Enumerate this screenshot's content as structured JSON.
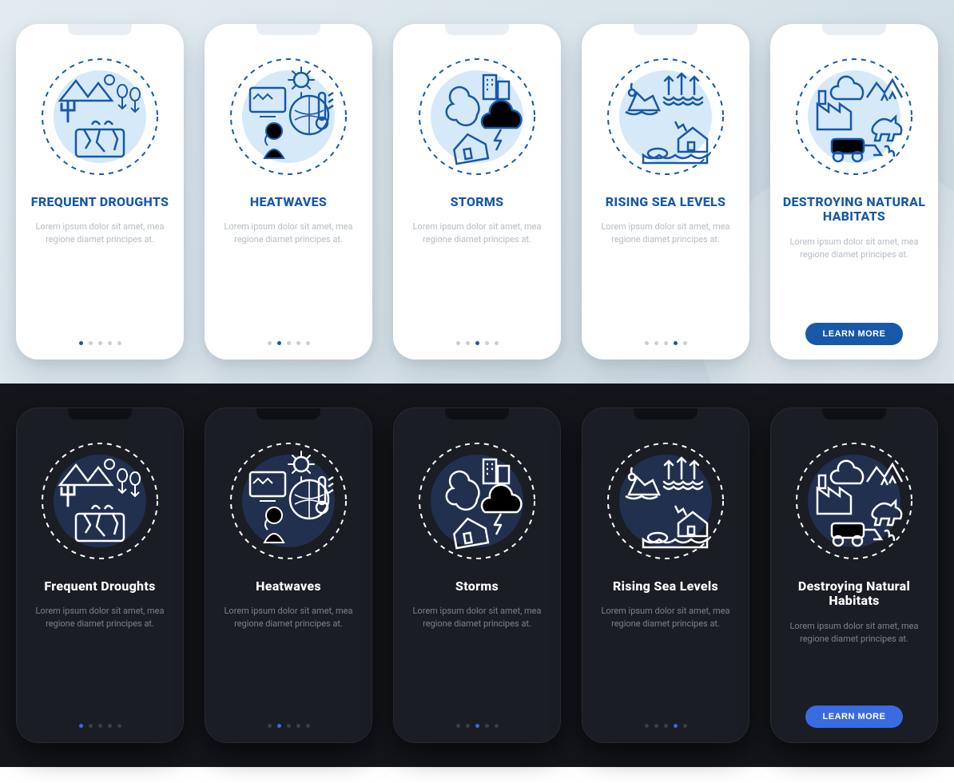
{
  "placeholder_text": "Lorem ipsum dolor sit amet, mea regione diamet principes at.",
  "cta_label": "LEARN MORE",
  "light": {
    "cards": [
      {
        "title": "FREQUENT DROUGHTS",
        "icon": "drought-icon"
      },
      {
        "title": "HEATWAVES",
        "icon": "heatwave-icon"
      },
      {
        "title": "STORMS",
        "icon": "storm-icon"
      },
      {
        "title": "RISING SEA LEVELS",
        "icon": "sea-level-icon"
      },
      {
        "title": "DESTROYING NATURAL HABITATS",
        "icon": "habitat-icon"
      }
    ]
  },
  "dark": {
    "cards": [
      {
        "title": "Frequent Droughts",
        "icon": "drought-icon"
      },
      {
        "title": "Heatwaves",
        "icon": "heatwave-icon"
      },
      {
        "title": "Storms",
        "icon": "storm-icon"
      },
      {
        "title": "Rising Sea Levels",
        "icon": "sea-level-icon"
      },
      {
        "title": "Destroying Natural Habitats",
        "icon": "habitat-icon"
      }
    ]
  },
  "colors": {
    "light_accent": "#1759a6",
    "light_fill": "#9ec9ee",
    "dark_accent": "#3a6be0",
    "dark_stroke": "#ffffff"
  }
}
